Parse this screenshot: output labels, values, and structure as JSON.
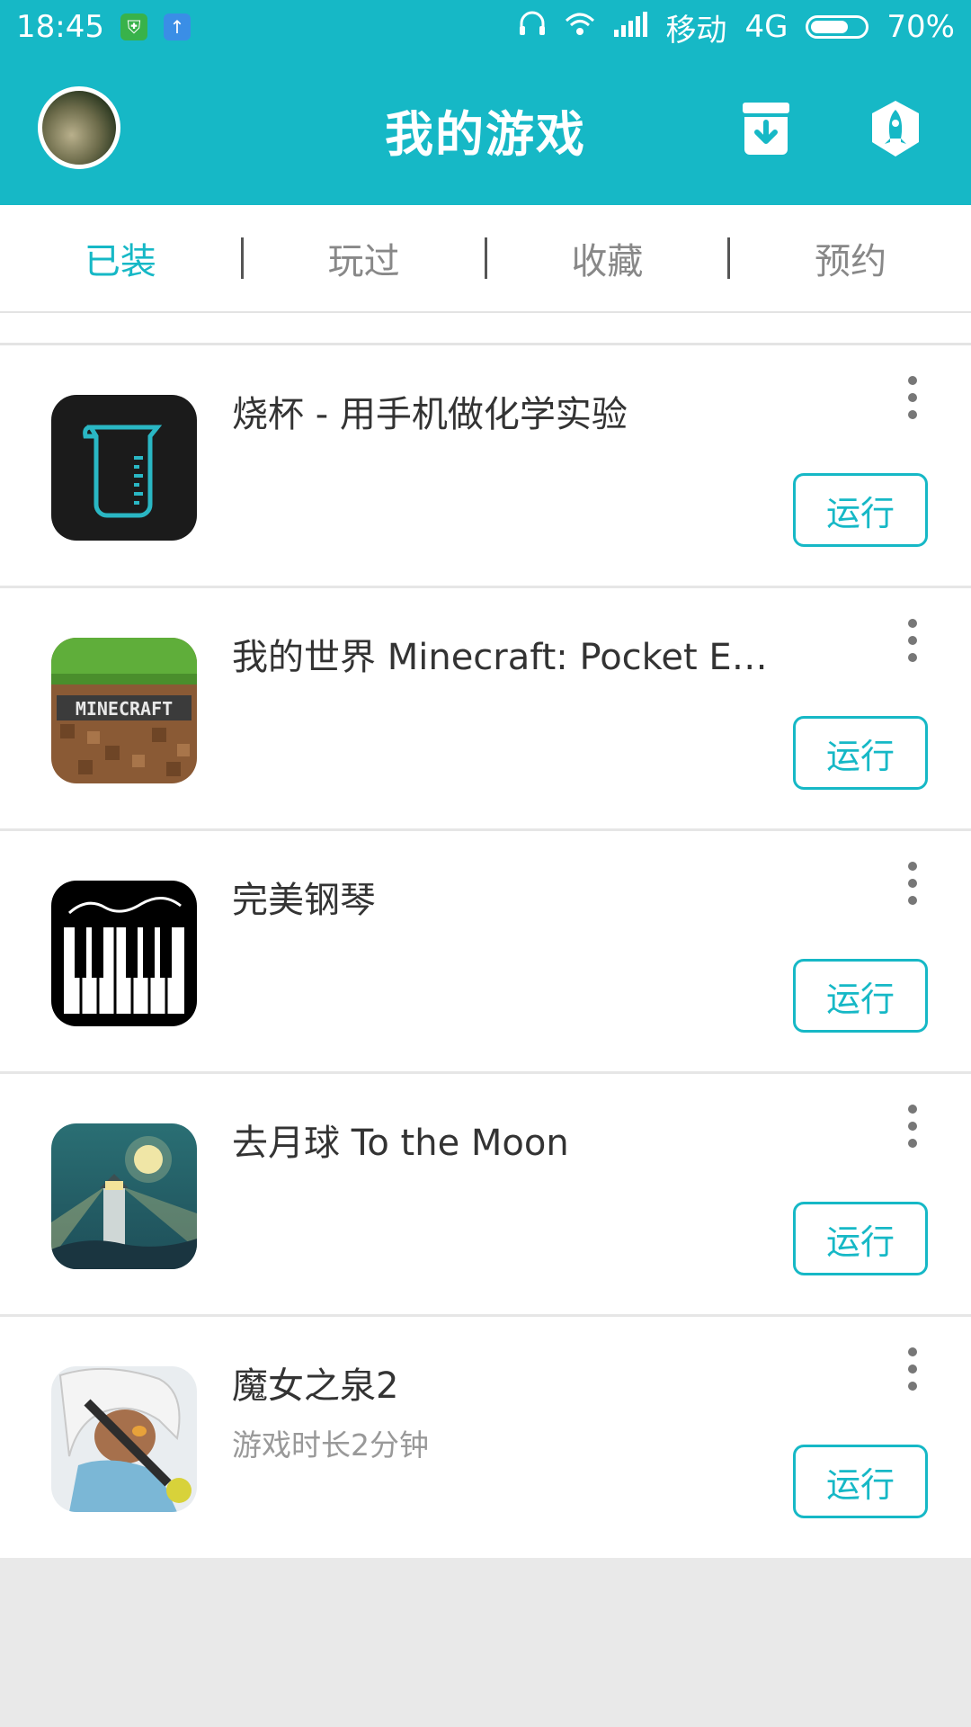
{
  "status_bar": {
    "time": "18:45",
    "carrier": "移动",
    "network": "4G",
    "battery_percent": "70%",
    "battery_level": 0.7
  },
  "header": {
    "title": "我的游戏"
  },
  "tabs": [
    {
      "label": "已装",
      "active": true
    },
    {
      "label": "玩过",
      "active": false
    },
    {
      "label": "收藏",
      "active": false
    },
    {
      "label": "预约",
      "active": false
    }
  ],
  "games": [
    {
      "name": "烧杯 - 用手机做化学实验",
      "subtitle": "",
      "action": "运行",
      "icon": "beaker-icon"
    },
    {
      "name": "我的世界 Minecraft: Pocket Ed…",
      "subtitle": "",
      "action": "运行",
      "icon": "minecraft-icon"
    },
    {
      "name": "完美钢琴",
      "subtitle": "",
      "action": "运行",
      "icon": "piano-icon"
    },
    {
      "name": "去月球 To the Moon",
      "subtitle": "",
      "action": "运行",
      "icon": "moon-lighthouse-icon"
    },
    {
      "name": "魔女之泉2",
      "subtitle": "游戏时长2分钟",
      "action": "运行",
      "icon": "witch-character-icon"
    }
  ],
  "colors": {
    "accent": "#16b8c6",
    "background": "#e9e9e9"
  }
}
